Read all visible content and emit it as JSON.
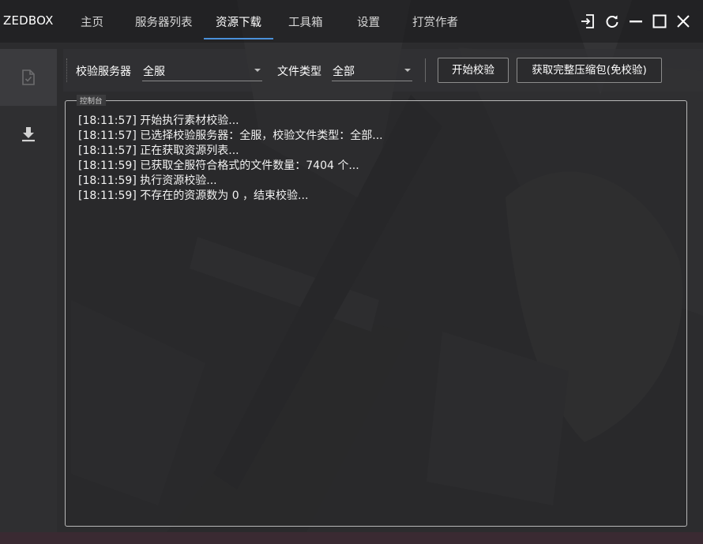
{
  "app": {
    "title": "ZEDBOX"
  },
  "nav": {
    "tabs": [
      {
        "label": "主页"
      },
      {
        "label": "服务器列表"
      },
      {
        "label": "资源下载"
      },
      {
        "label": "工具箱"
      },
      {
        "label": "设置"
      },
      {
        "label": "打赏作者"
      }
    ],
    "active_index": 2
  },
  "window_controls": {
    "icons": [
      "exit-icon",
      "refresh-icon",
      "minimize-icon",
      "maximize-icon",
      "close-icon"
    ]
  },
  "sidebar": {
    "items": [
      {
        "icon": "file-check-icon",
        "selected": true
      },
      {
        "icon": "download-icon",
        "selected": false
      }
    ]
  },
  "toolbar": {
    "server_label": "校验服务器",
    "server_value": "全服",
    "filetype_label": "文件类型",
    "filetype_value": "全部",
    "start_button": "开始校验",
    "package_button": "获取完整压缩包(免校验)"
  },
  "console": {
    "title": "控制台",
    "lines": [
      "[18:11:57] 开始执行素材校验...",
      "[18:11:57] 已选择校验服务器：全服，校验文件类型：全部...",
      "[18:11:57] 正在获取资源列表...",
      "[18:11:59] 已获取全服符合格式的文件数量：7404 个...",
      "[18:11:59] 执行资源校验...",
      "[18:11:59] 不存在的资源数为 0 ，结束校验..."
    ]
  },
  "colors": {
    "accent": "#4a90d9",
    "background": "#2b2b2d",
    "text": "#ffffff"
  }
}
